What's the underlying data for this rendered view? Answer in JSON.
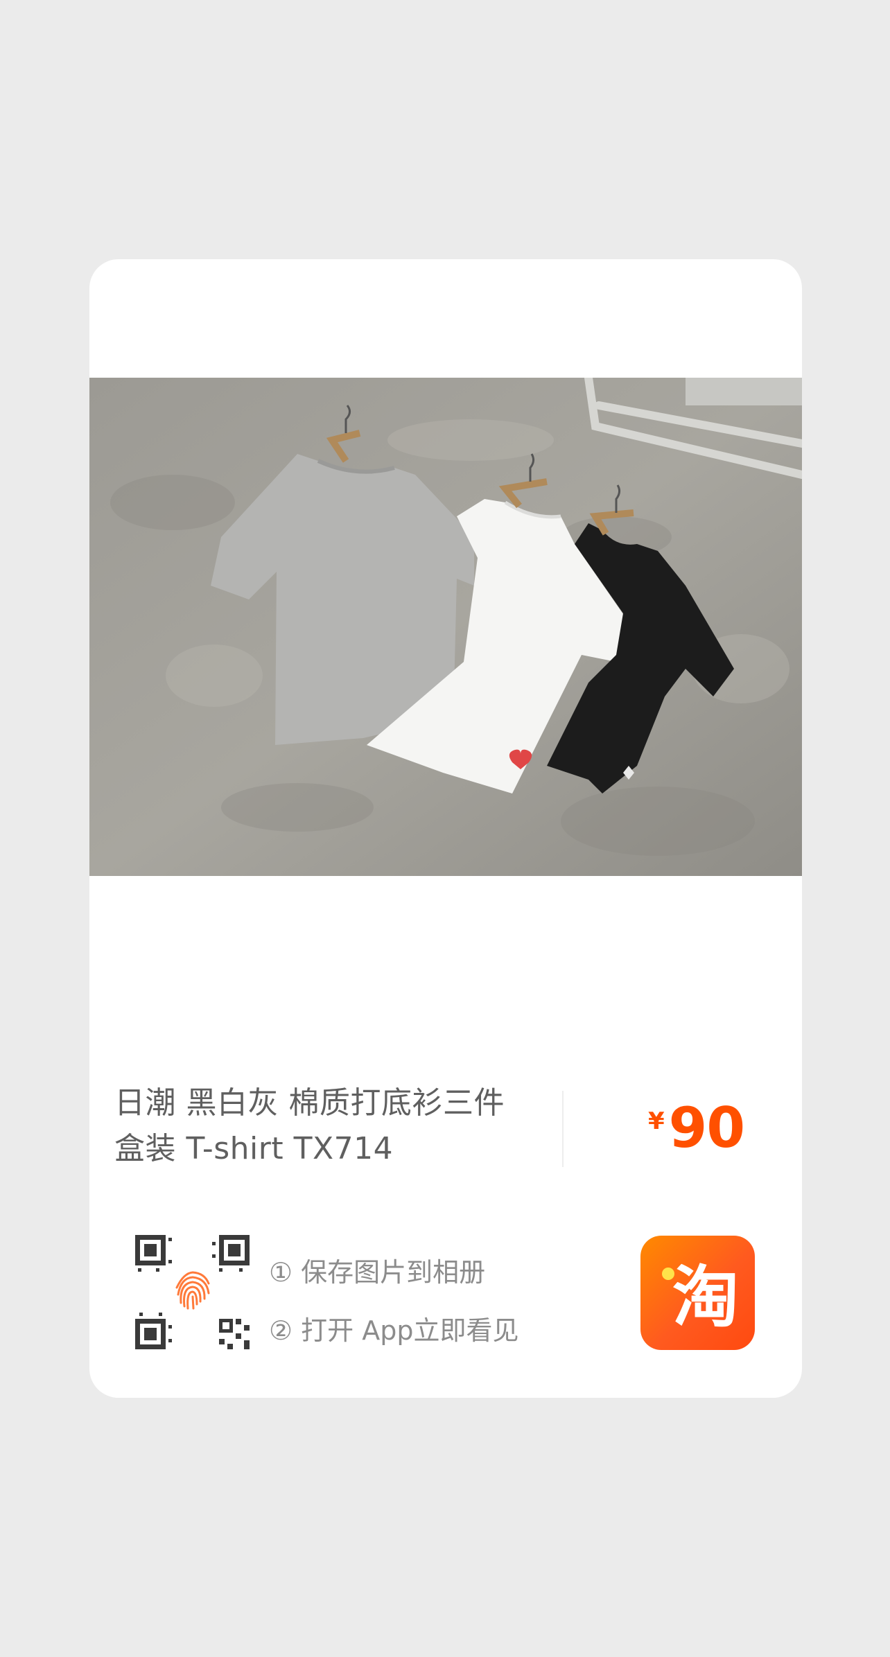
{
  "product": {
    "title": "日潮 黑白灰 棉质打底衫三件盒装 T-shirt TX714",
    "price_currency": "¥",
    "price_value": "90",
    "image_icon": "tshirt-photo"
  },
  "share": {
    "step_1": "① 保存图片到相册",
    "step_2": "② 打开 App立即看见",
    "scan_icon": "qr-fingerprint-icon",
    "app_icon": "taobao-logo-icon",
    "app_logo_glyph": "淘"
  },
  "colors": {
    "background": "#ebebeb",
    "card": "#ffffff",
    "price": "#ff5000",
    "brand_orange": "#ff5a1f"
  }
}
